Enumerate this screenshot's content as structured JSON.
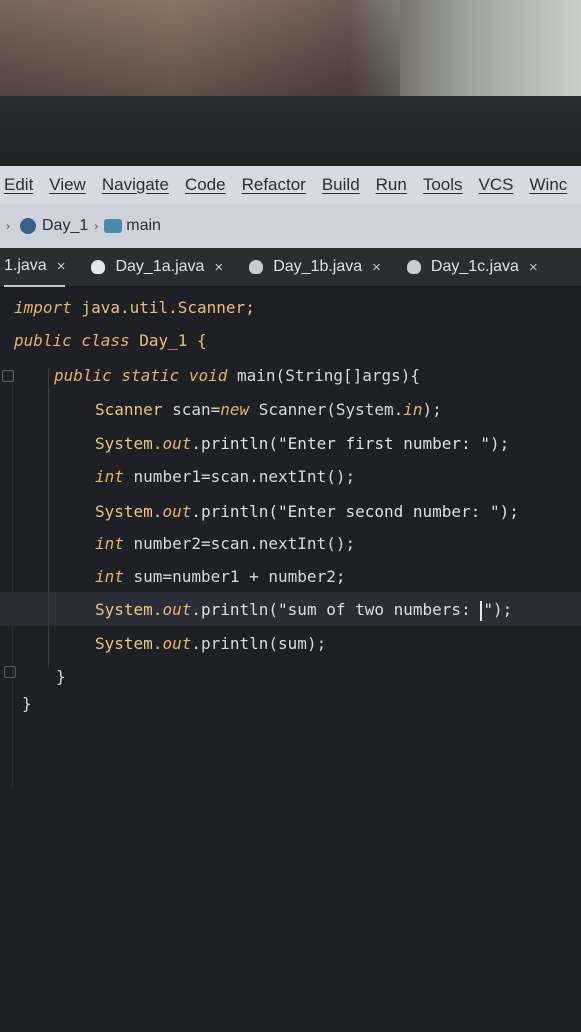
{
  "menu": [
    "Edit",
    "View",
    "Navigate",
    "Code",
    "Refactor",
    "Build",
    "Run",
    "Tools",
    "VCS",
    "Winc"
  ],
  "breadcrumb": {
    "project": "Day_1",
    "method": "main"
  },
  "tabs": [
    {
      "label": "1.java",
      "close": "×"
    },
    {
      "label": "Day_1a.java",
      "close": "×"
    },
    {
      "label": "Day_1b.java",
      "close": "×"
    },
    {
      "label": "Day_1c.java",
      "close": "×"
    }
  ],
  "code": {
    "l1": {
      "kw": "import",
      "rest": " java.util.Scanner;"
    },
    "l2": {
      "kw": "public class",
      "rest": " Day_1 {"
    },
    "l3": {
      "kw": "public static void",
      "rest": " main(String[]args){"
    },
    "l4": {
      "a": "Scanner",
      "b": " scan=",
      "c": "new",
      "d": " Scanner(System.",
      "e": "in",
      "f": ");"
    },
    "l5": {
      "a": "System.",
      "b": "out",
      "c": ".println(\"Enter first number: \");"
    },
    "l6": {
      "a": "int",
      "b": " number1=scan.nextInt();"
    },
    "l7": {
      "a": "System.",
      "b": "out",
      "c": ".println(\"Enter second number: \");"
    },
    "l8": {
      "a": "int",
      "b": " number2=scan.nextInt();"
    },
    "l9": {
      "a": "int",
      "b": " sum=number1 + number2;"
    },
    "l10": {
      "a": "System.",
      "b": "out",
      "c": ".println(\"sum of two numbers: ",
      "d": "\");"
    },
    "l11": {
      "a": "System.",
      "b": "out",
      "c": ".println(sum);"
    },
    "l12": "}",
    "l13": "}"
  }
}
